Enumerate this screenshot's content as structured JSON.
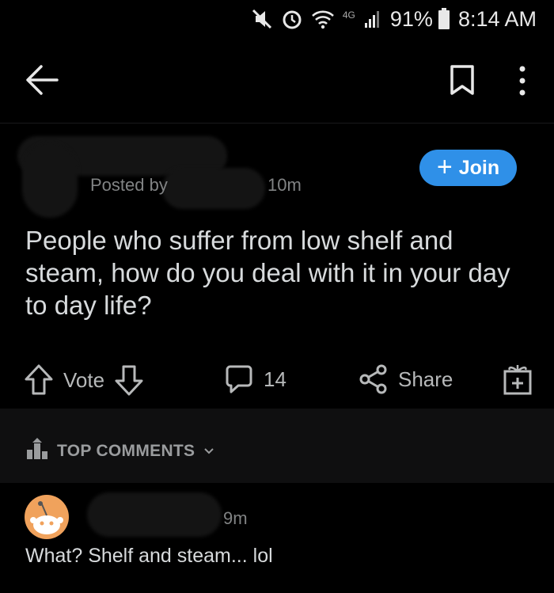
{
  "status_bar": {
    "network": "4G",
    "battery": "91%",
    "time": "8:14 AM"
  },
  "post": {
    "posted_by_label": "Posted by",
    "time_ago": "10m",
    "join_label": "Join",
    "title": "People who suffer from low shelf and steam, how do you deal with it in your day to day life?"
  },
  "actions": {
    "vote_label": "Vote",
    "comment_count": "14",
    "share_label": "Share"
  },
  "sort": {
    "label": "TOP COMMENTS"
  },
  "comment": {
    "time_ago": "9m",
    "body": "What? Shelf and steam... lol"
  },
  "colors": {
    "accent": "#2f90e8",
    "background": "#000000",
    "avatar": "#f0a25c"
  }
}
